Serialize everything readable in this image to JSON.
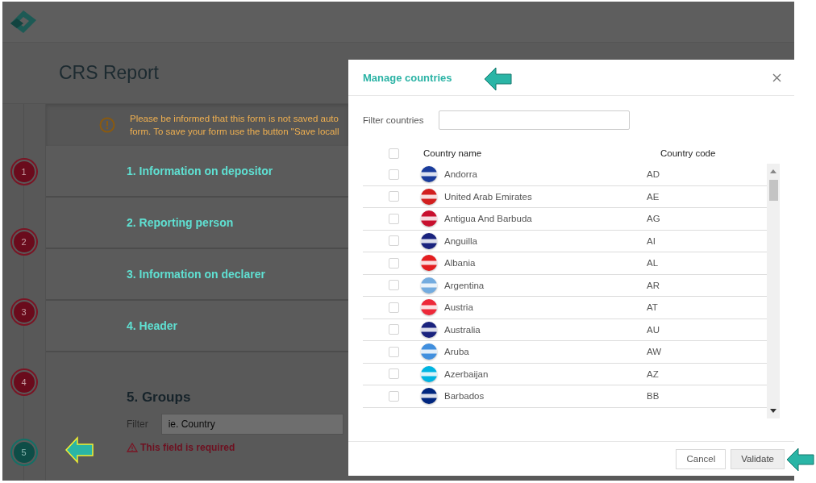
{
  "page": {
    "title": "CRS Report",
    "warning": [
      "Please be informed that this form is not saved auto",
      "form. To save your form use the button \"Save locall"
    ]
  },
  "steps": [
    {
      "label": "1",
      "selected": false
    },
    {
      "label": "2",
      "selected": false
    },
    {
      "label": "3",
      "selected": false
    },
    {
      "label": "4",
      "selected": false
    },
    {
      "label": "5",
      "selected": true
    }
  ],
  "sections": [
    "1. Information on depositor",
    "2. Reporting person",
    "3. Information on declarer",
    "4. Header"
  ],
  "groups": {
    "title": "5. Groups",
    "filter_label": "Filter",
    "placeholder": "ie. Country",
    "error": "This field is required"
  },
  "modal": {
    "title": "Manage countries",
    "filter_label": "Filter countries",
    "select_all": false,
    "columns": [
      "Country name",
      "Country code"
    ],
    "rows": [
      {
        "name": "Andorra",
        "code": "AD",
        "color": "#1a3c9c",
        "checked": false
      },
      {
        "name": "United Arab Emirates",
        "code": "AE",
        "color": "#d21f1f",
        "checked": false
      },
      {
        "name": "Antigua And Barbuda",
        "code": "AG",
        "color": "#c8102e",
        "checked": false
      },
      {
        "name": "Anguilla",
        "code": "AI",
        "color": "#1a237e",
        "checked": false
      },
      {
        "name": "Albania",
        "code": "AL",
        "color": "#e41e20",
        "checked": false
      },
      {
        "name": "Argentina",
        "code": "AR",
        "color": "#74acdf",
        "checked": false
      },
      {
        "name": "Austria",
        "code": "AT",
        "color": "#ed2939",
        "checked": false
      },
      {
        "name": "Australia",
        "code": "AU",
        "color": "#1a237e",
        "checked": false
      },
      {
        "name": "Aruba",
        "code": "AW",
        "color": "#418fde",
        "checked": false
      },
      {
        "name": "Azerbaijan",
        "code": "AZ",
        "color": "#00b5e2",
        "checked": false
      },
      {
        "name": "Barbados",
        "code": "BB",
        "color": "#00267f",
        "checked": false
      }
    ],
    "buttons": [
      "Cancel",
      "Validate"
    ]
  }
}
